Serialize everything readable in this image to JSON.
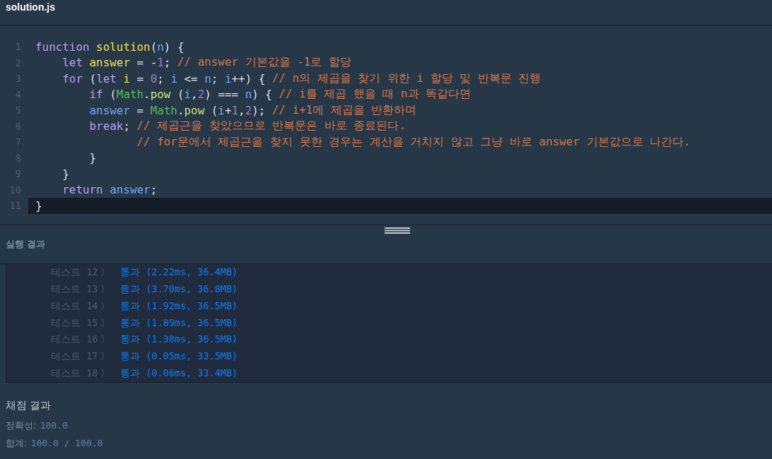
{
  "editor": {
    "filename": "solution.js",
    "lines": [
      {
        "number": "1",
        "selected": false,
        "tokens": [
          {
            "kind": "keyword",
            "text": "function"
          },
          {
            "kind": "def",
            "text": " solution"
          },
          {
            "kind": "punct",
            "text": "("
          },
          {
            "kind": "var",
            "text": "n"
          },
          {
            "kind": "punct",
            "text": ") {"
          }
        ]
      },
      {
        "number": "2",
        "selected": false,
        "tokens": [
          {
            "kind": "keyword",
            "text": "    let"
          },
          {
            "kind": "def",
            "text": " answer"
          },
          {
            "kind": "punct",
            "text": " = -"
          },
          {
            "kind": "num",
            "text": "1"
          },
          {
            "kind": "punct",
            "text": "; "
          },
          {
            "kind": "comment",
            "text": "// answer 기본값을 -1로 할당"
          }
        ]
      },
      {
        "number": "3",
        "selected": false,
        "tokens": [
          {
            "kind": "keyword",
            "text": "    for"
          },
          {
            "kind": "punct",
            "text": " ("
          },
          {
            "kind": "keyword",
            "text": "let"
          },
          {
            "kind": "def",
            "text": " i"
          },
          {
            "kind": "punct",
            "text": " = "
          },
          {
            "kind": "num",
            "text": "0"
          },
          {
            "kind": "punct",
            "text": "; "
          },
          {
            "kind": "var",
            "text": "i"
          },
          {
            "kind": "punct",
            "text": " <= "
          },
          {
            "kind": "var",
            "text": "n"
          },
          {
            "kind": "punct",
            "text": "; "
          },
          {
            "kind": "var",
            "text": "i"
          },
          {
            "kind": "punct",
            "text": "++) { "
          },
          {
            "kind": "comment",
            "text": "// n의 제곱을 찾기 위한 i 할당 및 반복문 진행"
          }
        ]
      },
      {
        "number": "4",
        "selected": false,
        "tokens": [
          {
            "kind": "keyword",
            "text": "        if"
          },
          {
            "kind": "punct",
            "text": " ("
          },
          {
            "kind": "builtin",
            "text": "Math"
          },
          {
            "kind": "punct",
            "text": "."
          },
          {
            "kind": "method",
            "text": "pow"
          },
          {
            "kind": "punct",
            "text": " ("
          },
          {
            "kind": "var",
            "text": "i"
          },
          {
            "kind": "punct",
            "text": ","
          },
          {
            "kind": "num",
            "text": "2"
          },
          {
            "kind": "punct",
            "text": ") === "
          },
          {
            "kind": "var",
            "text": "n"
          },
          {
            "kind": "punct",
            "text": ") { "
          },
          {
            "kind": "comment",
            "text": "// i를 제곱 했을 때 n과 똑같다면"
          }
        ]
      },
      {
        "number": "5",
        "selected": false,
        "tokens": [
          {
            "kind": "var",
            "text": "        answer"
          },
          {
            "kind": "punct",
            "text": " = "
          },
          {
            "kind": "builtin",
            "text": "Math"
          },
          {
            "kind": "punct",
            "text": "."
          },
          {
            "kind": "method",
            "text": "pow"
          },
          {
            "kind": "punct",
            "text": " ("
          },
          {
            "kind": "var",
            "text": "i"
          },
          {
            "kind": "punct",
            "text": "+"
          },
          {
            "kind": "num",
            "text": "1"
          },
          {
            "kind": "punct",
            "text": ","
          },
          {
            "kind": "num",
            "text": "2"
          },
          {
            "kind": "punct",
            "text": "); "
          },
          {
            "kind": "comment",
            "text": "// i+1에 제곱을 반환하며"
          }
        ]
      },
      {
        "number": "6",
        "selected": false,
        "tokens": [
          {
            "kind": "keyword",
            "text": "        break"
          },
          {
            "kind": "punct",
            "text": "; "
          },
          {
            "kind": "comment",
            "text": "// 제곱근을 찾았으므로 반복문은 바로 종료된다."
          }
        ]
      },
      {
        "number": "7",
        "selected": false,
        "tokens": [
          {
            "kind": "comment",
            "text": "               // for문에서 제곱근을 찾지 못한 경우는 계산을 거치지 않고 그냥 바로 answer 기본값으로 나간다."
          }
        ]
      },
      {
        "number": "8",
        "selected": false,
        "tokens": [
          {
            "kind": "punct",
            "text": "        }"
          }
        ]
      },
      {
        "number": "9",
        "selected": false,
        "tokens": [
          {
            "kind": "punct",
            "text": "    }"
          }
        ]
      },
      {
        "number": "10",
        "selected": false,
        "tokens": [
          {
            "kind": "keyword",
            "text": "    return"
          },
          {
            "kind": "var",
            "text": " answer"
          },
          {
            "kind": "punct",
            "text": ";"
          }
        ]
      },
      {
        "number": "11",
        "selected": true,
        "tokens": [
          {
            "kind": "punct",
            "text": "}"
          }
        ]
      }
    ]
  },
  "run_results": {
    "title": "실행 결과",
    "rows": [
      {
        "label": "테스트 12",
        "separator": "〉",
        "result": "통과 (2.22ms, 36.4MB)"
      },
      {
        "label": "테스트 13",
        "separator": "〉",
        "result": "통과 (3.70ms, 36.8MB)"
      },
      {
        "label": "테스트 14",
        "separator": "〉",
        "result": "통과 (1.92ms, 36.5MB)"
      },
      {
        "label": "테스트 15",
        "separator": "〉",
        "result": "통과 (1.89ms, 36.5MB)"
      },
      {
        "label": "테스트 16",
        "separator": "〉",
        "result": "통과 (1.38ms, 36.5MB)"
      },
      {
        "label": "테스트 17",
        "separator": "〉",
        "result": "통과 (0.05ms, 33.5MB)"
      },
      {
        "label": "테스트 18",
        "separator": "〉",
        "result": "통과 (0.06ms, 33.4MB)"
      }
    ]
  },
  "grading": {
    "title": "채점 결과",
    "items": [
      {
        "label": "정확성:",
        "value": "100.0"
      },
      {
        "label": "합계:",
        "value": "100.0 / 100.0"
      }
    ]
  }
}
